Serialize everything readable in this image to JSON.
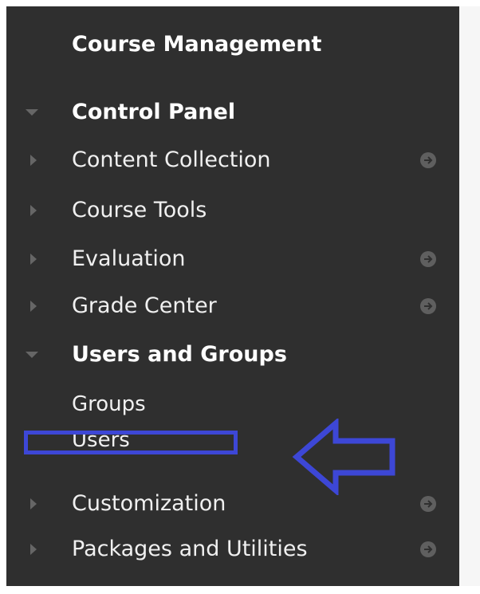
{
  "panel": {
    "title": "Course Management"
  },
  "menu": {
    "items": [
      {
        "label": "Control Panel",
        "bold": true,
        "expanded": true,
        "has_go_icon": false
      },
      {
        "label": "Content Collection",
        "bold": false,
        "expanded": false,
        "has_go_icon": true
      },
      {
        "label": "Course Tools",
        "bold": false,
        "expanded": false,
        "has_go_icon": false
      },
      {
        "label": "Evaluation",
        "bold": false,
        "expanded": false,
        "has_go_icon": true
      },
      {
        "label": "Grade Center",
        "bold": false,
        "expanded": false,
        "has_go_icon": true
      },
      {
        "label": "Users and Groups",
        "bold": true,
        "expanded": true,
        "has_go_icon": false
      },
      {
        "label": "Customization",
        "bold": false,
        "expanded": false,
        "has_go_icon": true
      },
      {
        "label": "Packages and Utilities",
        "bold": false,
        "expanded": false,
        "has_go_icon": true
      }
    ],
    "users_and_groups_children": [
      {
        "label": "Groups"
      },
      {
        "label": "Users"
      }
    ]
  },
  "colors": {
    "panel_bg": "#2f2f2f",
    "annotation_blue": "#3d47d6",
    "arrow_icon": "#5f5f5f"
  },
  "icons": {
    "collapsed": "triangle-right-icon",
    "expanded": "triangle-down-icon",
    "go": "arrow-circle-right-icon"
  }
}
